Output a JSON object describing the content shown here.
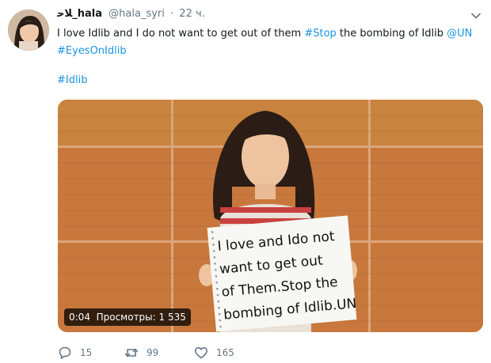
{
  "tweet": {
    "display_name": "ﻼﺣ_hala",
    "handle": "@hala_syri",
    "separator": "·",
    "timestamp": "22 ч.",
    "text_line1_prefix": "I love Idlib and I do not want to get out of them",
    "hashtag_stop": "#Stop",
    "text_line1_middle": "the bombing of Idlib",
    "mention_un": "@UN",
    "hashtag_eyes": "#EyesOnIdlib",
    "hashtag_idlib": "#Idlib"
  },
  "video": {
    "duration": "0:04",
    "views_label": "Просмотры: 1 535",
    "sign_lines": [
      "I love and Ido not",
      "want to get out",
      "of Them.Stop the",
      "bombing of Idlib.UN"
    ]
  },
  "actions": {
    "reply_count": "15",
    "retweet_count": "99",
    "like_count": "165"
  },
  "colors": {
    "link": "#1b95e0",
    "muted": "#657786",
    "text": "#14171a"
  }
}
